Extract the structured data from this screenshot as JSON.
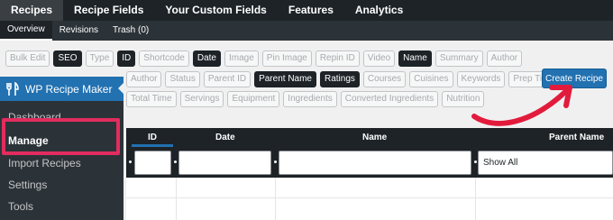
{
  "topnav": {
    "tabs": [
      "Recipes",
      "Recipe Fields",
      "Your Custom Fields",
      "Features",
      "Analytics"
    ]
  },
  "subnav": {
    "tabs": [
      "Overview",
      "Revisions",
      "Trash (0)"
    ]
  },
  "toggles": {
    "row1": [
      {
        "label": "Bulk Edit",
        "on": false
      },
      {
        "label": "SEO",
        "on": true
      },
      {
        "label": "Type",
        "on": false
      },
      {
        "label": "ID",
        "on": true
      },
      {
        "label": "Shortcode",
        "on": false
      },
      {
        "label": "Date",
        "on": true
      },
      {
        "label": "Image",
        "on": false
      },
      {
        "label": "Pin Image",
        "on": false
      },
      {
        "label": "Repin ID",
        "on": false
      },
      {
        "label": "Video",
        "on": false
      },
      {
        "label": "Name",
        "on": true
      },
      {
        "label": "Summary",
        "on": false
      },
      {
        "label": "Author",
        "on": false
      }
    ],
    "row2": [
      {
        "label": "Author",
        "on": false
      },
      {
        "label": "Status",
        "on": false
      },
      {
        "label": "Parent ID",
        "on": false
      },
      {
        "label": "Parent Name",
        "on": true
      },
      {
        "label": "Ratings",
        "on": true
      },
      {
        "label": "Courses",
        "on": false
      },
      {
        "label": "Cuisines",
        "on": false
      },
      {
        "label": "Keywords",
        "on": false
      },
      {
        "label": "Prep Time",
        "on": false
      }
    ],
    "row3": [
      {
        "label": "Total Time",
        "on": false
      },
      {
        "label": "Servings",
        "on": false
      },
      {
        "label": "Equipment",
        "on": false
      },
      {
        "label": "Ingredients",
        "on": false
      },
      {
        "label": "Converted Ingredients",
        "on": false
      },
      {
        "label": "Nutrition",
        "on": false
      }
    ]
  },
  "create_button": "Create Recipe",
  "sidebar": {
    "plugin_title": "WP Recipe Maker",
    "items": [
      "Dashboard",
      "Manage",
      "Import Recipes",
      "Settings",
      "Tools"
    ],
    "current": "Manage"
  },
  "table": {
    "headers": [
      "ID",
      "Date",
      "Name",
      "Parent Name"
    ],
    "filter_select": "Show All"
  },
  "colors": {
    "highlight": "#e22c5f",
    "accent": "#2271b1",
    "arrow": "#e21b3c"
  }
}
